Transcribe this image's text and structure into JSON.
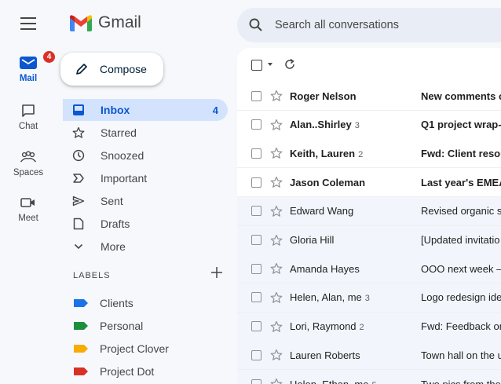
{
  "app": {
    "name": "Gmail"
  },
  "search": {
    "placeholder": "Search all conversations"
  },
  "rail": [
    {
      "key": "mail",
      "label": "Mail",
      "icon": "mail-icon",
      "badge": "4",
      "active": true
    },
    {
      "key": "chat",
      "label": "Chat",
      "icon": "chat-icon"
    },
    {
      "key": "spaces",
      "label": "Spaces",
      "icon": "spaces-icon"
    },
    {
      "key": "meet",
      "label": "Meet",
      "icon": "meet-icon"
    }
  ],
  "compose": {
    "label": "Compose"
  },
  "nav": [
    {
      "key": "inbox",
      "label": "Inbox",
      "icon": "inbox-icon",
      "count": "4",
      "active": true
    },
    {
      "key": "starred",
      "label": "Starred",
      "icon": "star-icon"
    },
    {
      "key": "snoozed",
      "label": "Snoozed",
      "icon": "clock-icon"
    },
    {
      "key": "important",
      "label": "Important",
      "icon": "important-icon"
    },
    {
      "key": "sent",
      "label": "Sent",
      "icon": "send-icon"
    },
    {
      "key": "drafts",
      "label": "Drafts",
      "icon": "draft-icon"
    },
    {
      "key": "more",
      "label": "More",
      "icon": "chevron-down-icon"
    }
  ],
  "labels": {
    "heading": "LABELS",
    "items": [
      {
        "label": "Clients",
        "color": "#1a73e8"
      },
      {
        "label": "Personal",
        "color": "#1e8e3e"
      },
      {
        "label": "Project Clover",
        "color": "#f9ab00"
      },
      {
        "label": "Project Dot",
        "color": "#d93025"
      }
    ]
  },
  "colors": {
    "accent": "#0b57d0",
    "active_nav": "#d3e3fd",
    "badge": "#d93025"
  },
  "emails": [
    {
      "sender": "Roger Nelson",
      "count": "",
      "subject": "New comments o",
      "unread": true
    },
    {
      "sender": "Alan..Shirley",
      "count": "3",
      "subject": "Q1 project wrap-u",
      "unread": true
    },
    {
      "sender": "Keith, Lauren",
      "count": "2",
      "subject": "Fwd: Client resou",
      "unread": true
    },
    {
      "sender": "Jason Coleman",
      "count": "",
      "subject": "Last year's EMEA",
      "unread": true
    },
    {
      "sender": "Edward Wang",
      "count": "",
      "subject": "Revised organic s",
      "unread": false
    },
    {
      "sender": "Gloria Hill",
      "count": "",
      "subject": "[Updated invitatio",
      "unread": false
    },
    {
      "sender": "Amanda Hayes",
      "count": "",
      "subject": "OOO next week —",
      "unread": false
    },
    {
      "sender": "Helen, Alan, me",
      "count": "3",
      "subject": "Logo redesign ide",
      "unread": false
    },
    {
      "sender": "Lori, Raymond",
      "count": "2",
      "subject": "Fwd: Feedback on",
      "unread": false
    },
    {
      "sender": "Lauren Roberts",
      "count": "",
      "subject": "Town hall on the u",
      "unread": false
    },
    {
      "sender": "Helen, Ethan, me",
      "count": "5",
      "subject": "Two pics from the",
      "unread": false
    }
  ]
}
